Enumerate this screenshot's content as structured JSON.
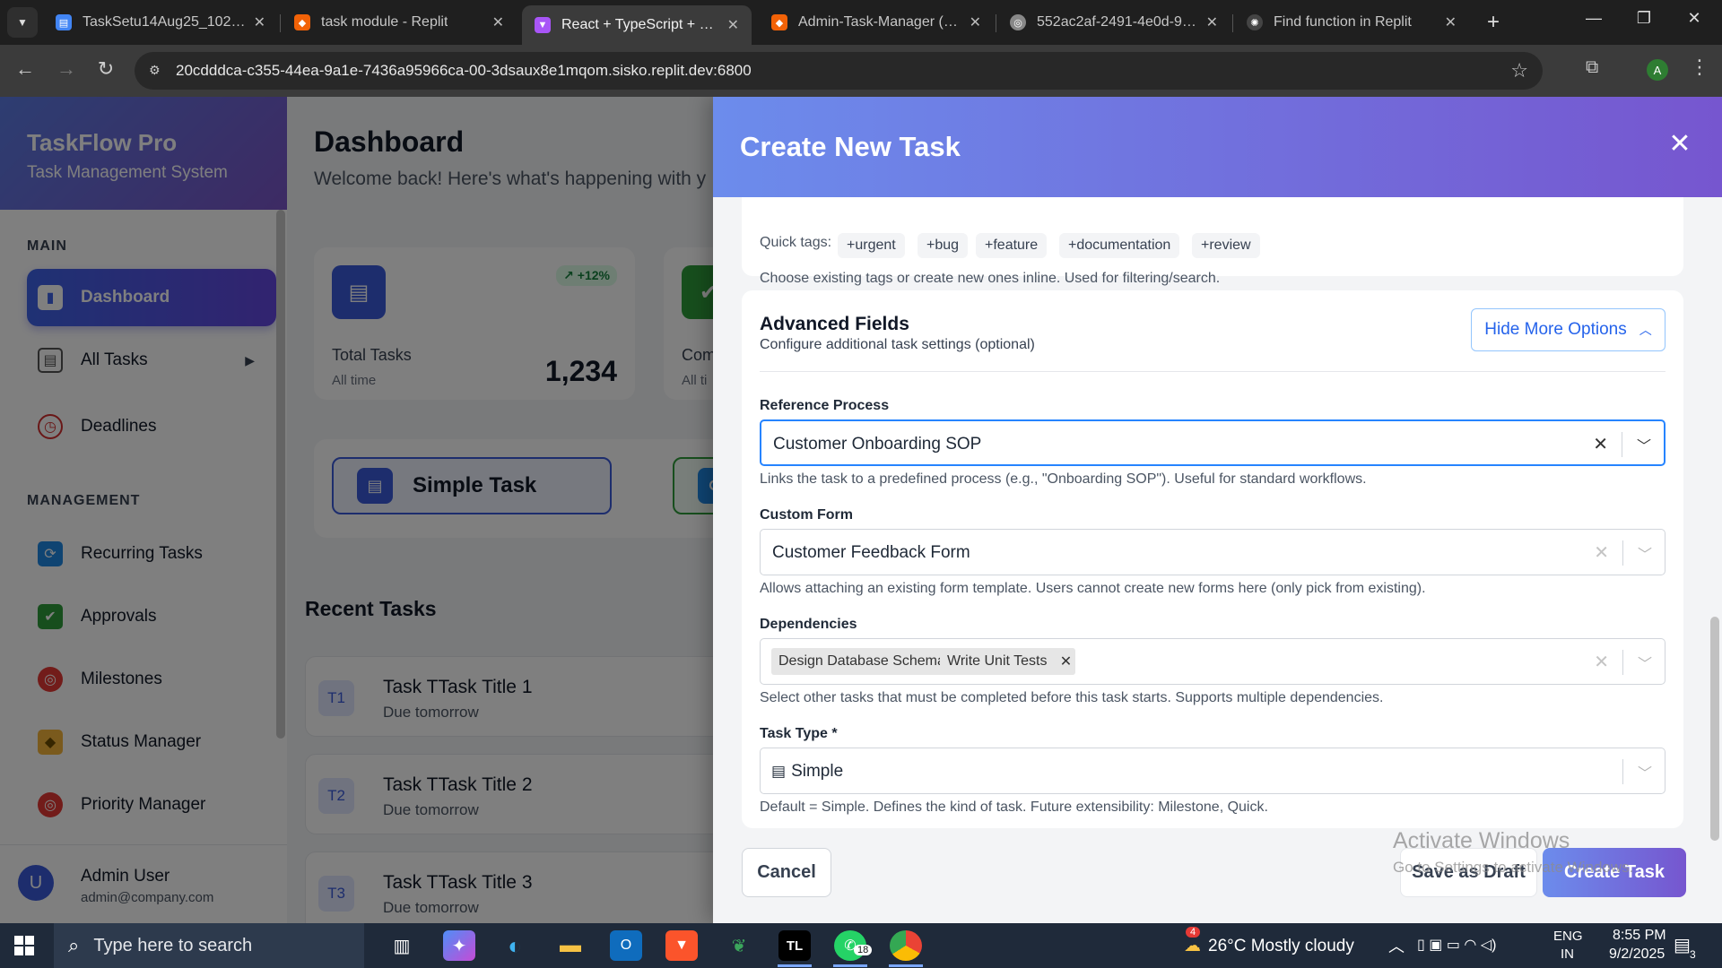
{
  "browser": {
    "tabs": [
      {
        "title": "TaskSetu14Aug25_102020...",
        "favicon": "docs-icon",
        "color": "#4285f4"
      },
      {
        "title": "task module - Replit",
        "favicon": "replit-icon",
        "color": "#f26207"
      },
      {
        "title": "React + TypeScript + Replit",
        "favicon": "vite-icon",
        "color": "#a855f7"
      },
      {
        "title": "Admin-Task-Manager (1) -",
        "favicon": "replit-icon",
        "color": "#f26207"
      },
      {
        "title": "552ac2af-2491-4e0d-9aad",
        "favicon": "globe-icon",
        "color": "#888888"
      },
      {
        "title": "Find function in Replit",
        "favicon": "chatgpt-icon",
        "color": "#dddddd"
      }
    ],
    "url": "20cdddca-c355-44ea-9a1e-7436a95966ca-00-3dsaux8e1mqom.sisko.replit.dev:6800",
    "profile_initial": "A"
  },
  "sidebar": {
    "brand_name": "TaskFlow Pro",
    "brand_sub": "Task Management System",
    "section_main": "MAIN",
    "main_items": [
      {
        "label": "Dashboard",
        "icon": "bar-chart-icon",
        "active": true
      },
      {
        "label": "All Tasks",
        "icon": "clipboard-icon",
        "has_submenu": true
      },
      {
        "label": "Deadlines",
        "icon": "alarm-clock-icon"
      }
    ],
    "section_management": "MANAGEMENT",
    "management_items": [
      {
        "label": "Recurring Tasks",
        "icon": "repeat-icon"
      },
      {
        "label": "Approvals",
        "icon": "check-box-icon"
      },
      {
        "label": "Milestones",
        "icon": "target-icon"
      },
      {
        "label": "Status Manager",
        "icon": "tag-icon"
      },
      {
        "label": "Priority Manager",
        "icon": "target-icon"
      }
    ],
    "user": {
      "initial": "U",
      "name": "Admin User",
      "email": "admin@company.com"
    }
  },
  "dashboard": {
    "title": "Dashboard",
    "welcome": "Welcome back! Here's what's happening with y",
    "stats": [
      {
        "label": "Total Tasks",
        "sub": "All time",
        "value": "1,234",
        "trend": "↗ +12%"
      },
      {
        "label": "Com",
        "sub": "All ti",
        "value": "",
        "trend": ""
      }
    ],
    "quick_action": "Simple Task",
    "recent_title": "Recent Tasks",
    "recent_tasks": [
      {
        "badge": "T1",
        "title": "Task TTask Title 1",
        "due": "Due tomorrow"
      },
      {
        "badge": "T2",
        "title": "Task TTask Title 2",
        "due": "Due tomorrow"
      },
      {
        "badge": "T3",
        "title": "Task TTask Title 3",
        "due": "Due tomorrow"
      }
    ]
  },
  "modal": {
    "title": "Create New Task",
    "quick_tags_label": "Quick tags:",
    "quick_tags": [
      "+urgent",
      "+bug",
      "+feature",
      "+documentation",
      "+review"
    ],
    "tags_help": "Choose existing tags or create new ones inline. Used for filtering/search.",
    "advanced": {
      "title": "Advanced Fields",
      "subtitle": "Configure additional task settings (optional)",
      "toggle_label": "Hide More Options"
    },
    "fields": {
      "reference_process": {
        "label": "Reference Process",
        "value": "Customer Onboarding SOP",
        "help": "Links the task to a predefined process (e.g., \"Onboarding SOP\"). Useful for standard workflows."
      },
      "custom_form": {
        "label": "Custom Form",
        "value": "Customer Feedback Form",
        "help": "Allows attaching an existing form template. Users cannot create new forms here (only pick from existing)."
      },
      "dependencies": {
        "label": "Dependencies",
        "values": [
          "Design Database Schema",
          "Write Unit Tests"
        ],
        "help": "Select other tasks that must be completed before this task starts. Supports multiple dependencies."
      },
      "task_type": {
        "label": "Task Type *",
        "value": "Simple",
        "help": "Default = Simple. Defines the kind of task. Future extensibility: Milestone, Quick."
      }
    },
    "buttons": {
      "cancel": "Cancel",
      "draft": "Save as Draft",
      "create": "Create Task"
    }
  },
  "watermark": {
    "line1": "Activate Windows",
    "line2": "Go to Settings to activate Windows."
  },
  "taskbar": {
    "search_placeholder": "Type here to search",
    "weather_badge": "4",
    "weather": "26°C  Mostly cloudy",
    "lang_top": "ENG",
    "lang_bottom": "IN",
    "time": "8:55 PM",
    "date": "9/2/2025",
    "whatsapp_badge": "18",
    "notif_count": "3"
  }
}
